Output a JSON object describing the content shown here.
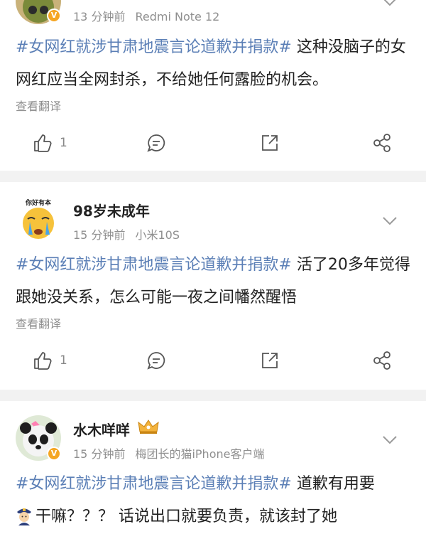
{
  "posts": [
    {
      "username": "",
      "time": "13 分钟前",
      "device": "Redmi Note 12",
      "hashtag": "#女网红就涉甘肃地震言论道歉并捐款#",
      "text": " 这种没脑子的女网红应当全网封杀，不给她任何露脸的机会。",
      "translate": "查看翻译",
      "like_count": "1"
    },
    {
      "username": "98岁未成年",
      "avatar_text": "你好有本",
      "time": "15 分钟前",
      "device": "小米10S",
      "hashtag": "#女网红就涉甘肃地震言论道歉并捐款#",
      "text": " 活了20多年觉得跟她没关系，怎么可能一夜之间幡然醒悟",
      "translate": "查看翻译",
      "like_count": "1"
    },
    {
      "username": "水木咩咩",
      "time": "15 分钟前",
      "device": "梅团长的猫iPhone客户端",
      "hashtag": "#女网红就涉甘肃地震言论道歉并捐款#",
      "text": " 道歉有用要",
      "text2": "干嘛？？？ 话说出口就要负责，就该封了她"
    }
  ],
  "colors": {
    "hashtag": "#5b7fb6",
    "meta": "#8f8f8f",
    "badge": "#f5a623",
    "separator": "#f2f2f2"
  },
  "icons": [
    "like-icon",
    "comment-icon",
    "share-icon",
    "more-share-icon",
    "chevron-down-icon",
    "verified-badge-icon",
    "crown-icon",
    "police-emoji-icon"
  ]
}
